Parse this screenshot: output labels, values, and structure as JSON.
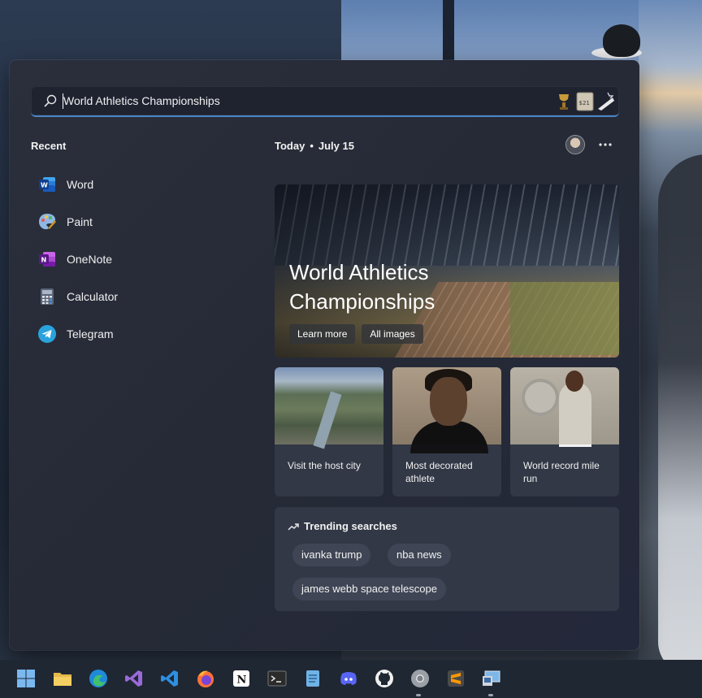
{
  "search": {
    "value": "World Athletics Championships",
    "doodle_label": "$21"
  },
  "recent": {
    "title": "Recent",
    "items": [
      {
        "label": "Word",
        "icon": "word-icon",
        "color": "#2b5797"
      },
      {
        "label": "Paint",
        "icon": "paint-icon",
        "color": "#6aa0d8"
      },
      {
        "label": "OneNote",
        "icon": "onenote-icon",
        "color": "#7b3fb0"
      },
      {
        "label": "Calculator",
        "icon": "calculator-icon",
        "color": "#5a6a80"
      },
      {
        "label": "Telegram",
        "icon": "telegram-icon",
        "color": "#2aa3dd"
      }
    ]
  },
  "today": {
    "label": "Today",
    "separator": "•",
    "date": "July 15"
  },
  "hero": {
    "title": "World Athletics Championships",
    "learn_more": "Learn more",
    "all_images": "All images"
  },
  "cards": [
    {
      "label": "Visit the host city"
    },
    {
      "label": "Most decorated athlete"
    },
    {
      "label": "World record mile run"
    }
  ],
  "trending": {
    "title": "Trending searches",
    "items": [
      "ivanka trump",
      "nba news",
      "james webb space telescope"
    ]
  },
  "taskbar": {
    "apps": [
      {
        "icon": "windows-start-icon"
      },
      {
        "icon": "file-explorer-icon"
      },
      {
        "icon": "edge-icon"
      },
      {
        "icon": "visual-studio-icon"
      },
      {
        "icon": "vscode-icon"
      },
      {
        "icon": "firefox-icon"
      },
      {
        "icon": "notion-icon"
      },
      {
        "icon": "terminal-icon"
      },
      {
        "icon": "notepad-icon"
      },
      {
        "icon": "discord-icon"
      },
      {
        "icon": "github-icon"
      },
      {
        "icon": "chrome-icon"
      },
      {
        "icon": "sublime-text-icon"
      },
      {
        "icon": "remote-desktop-icon"
      }
    ]
  },
  "colors": {
    "accent": "#4a86c7",
    "panel": "#262a36",
    "card": "#323846",
    "pill": "#3f4554"
  }
}
